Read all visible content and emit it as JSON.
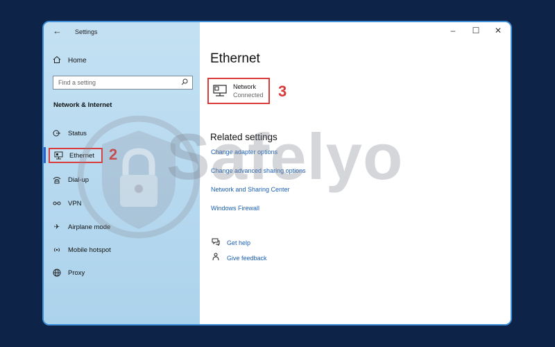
{
  "window": {
    "title": "Settings",
    "back_icon": "back-arrow-icon",
    "minimize": "—",
    "maximize": "☐",
    "close": "✕"
  },
  "sidebar": {
    "home_label": "Home",
    "search_placeholder": "Find a setting",
    "section_title": "Network & Internet",
    "items": [
      {
        "label": "Status",
        "icon": "status-icon"
      },
      {
        "label": "Ethernet",
        "icon": "ethernet-icon",
        "selected": true
      },
      {
        "label": "Dial-up",
        "icon": "dialup-icon"
      },
      {
        "label": "VPN",
        "icon": "vpn-icon"
      },
      {
        "label": "Airplane mode",
        "icon": "airplane-icon"
      },
      {
        "label": "Mobile hotspot",
        "icon": "hotspot-icon"
      },
      {
        "label": "Proxy",
        "icon": "globe-icon"
      }
    ]
  },
  "main": {
    "page_title": "Ethernet",
    "network": {
      "name": "Network",
      "status": "Connected"
    },
    "related_title": "Related settings",
    "links": [
      "Change adapter options",
      "Change advanced sharing options",
      "Network and Sharing Center",
      "Windows Firewall"
    ],
    "help": [
      {
        "label": "Get help",
        "icon": "help-chat-icon"
      },
      {
        "label": "Give feedback",
        "icon": "feedback-icon"
      }
    ]
  },
  "annotations": {
    "step2": "2",
    "step3": "3"
  },
  "watermark": {
    "text": "Safelyo"
  },
  "colors": {
    "background": "#0d2348",
    "frame_border": "#3d8fd9",
    "sidebar": "#b5d8ef",
    "highlight": "#d93a3a",
    "link": "#1a5fb4",
    "selection_bar": "#2a63c4"
  }
}
